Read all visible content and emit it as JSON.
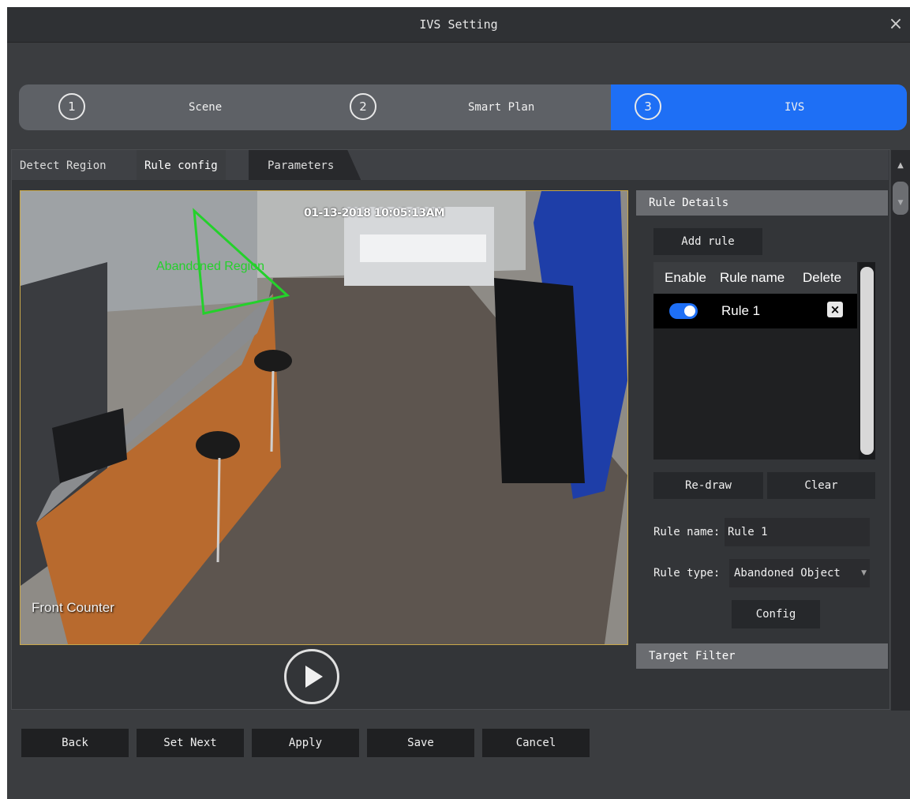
{
  "window": {
    "title": "IVS Setting",
    "close_glyph": "×"
  },
  "wizard": {
    "steps": [
      {
        "number": "1",
        "label": "Scene"
      },
      {
        "number": "2",
        "label": "Smart Plan"
      },
      {
        "number": "3",
        "label": "IVS"
      }
    ],
    "active_color": "#1e6ff5"
  },
  "tabs": [
    "Detect Region",
    "Rule config",
    "Parameters"
  ],
  "video": {
    "timestamp": "01-13-2018 10:05:13AM",
    "camera_label": "Front Counter",
    "region_label": "Abandoned Region",
    "region_color": "#24d12b",
    "play_icon": "play-icon"
  },
  "rule_details": {
    "header": "Rule Details",
    "add_rule_label": "Add rule",
    "table": {
      "columns": [
        "Enable",
        "Rule name",
        "Delete"
      ],
      "rows": [
        {
          "enabled": true,
          "name": "Rule 1",
          "delete_glyph": "×"
        }
      ]
    },
    "redraw_label": "Re-draw",
    "clear_label": "Clear",
    "rule_name_label": "Rule name:",
    "rule_name_value": "Rule 1",
    "rule_type_label": "Rule type:",
    "rule_type_value": "Abandoned Object",
    "config_label": "Config"
  },
  "target_filter": {
    "header": "Target Filter"
  },
  "footer": {
    "buttons": [
      "Back",
      "Set Next",
      "Apply",
      "Save",
      "Cancel"
    ]
  }
}
